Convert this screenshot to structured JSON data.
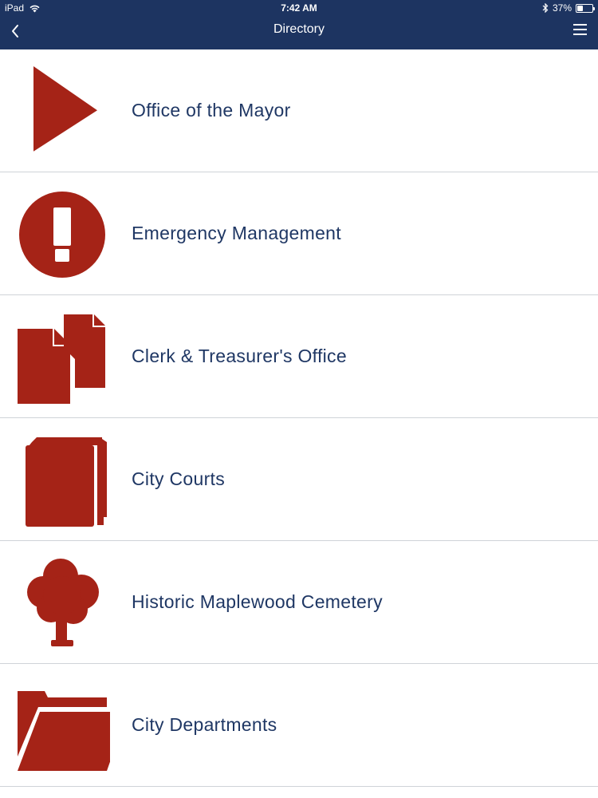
{
  "status_bar": {
    "device": "iPad",
    "time": "7:42 AM",
    "battery_percent": "37%",
    "battery_level": 0.37
  },
  "nav": {
    "title": "Directory",
    "back_icon": "chevron-left-icon",
    "menu_icon": "hamburger-menu-icon"
  },
  "colors": {
    "nav_background": "#1d3461",
    "icon_red": "#a52317",
    "label_blue": "#1f3764"
  },
  "directory": [
    {
      "label": "Office of the Mayor",
      "icon": "play-icon"
    },
    {
      "label": "Emergency Management",
      "icon": "alert-icon"
    },
    {
      "label": "Clerk & Treasurer's Office",
      "icon": "documents-icon"
    },
    {
      "label": "City Courts",
      "icon": "book-icon"
    },
    {
      "label": "Historic Maplewood Cemetery",
      "icon": "tree-icon"
    },
    {
      "label": "City Departments",
      "icon": "folder-open-icon"
    }
  ]
}
